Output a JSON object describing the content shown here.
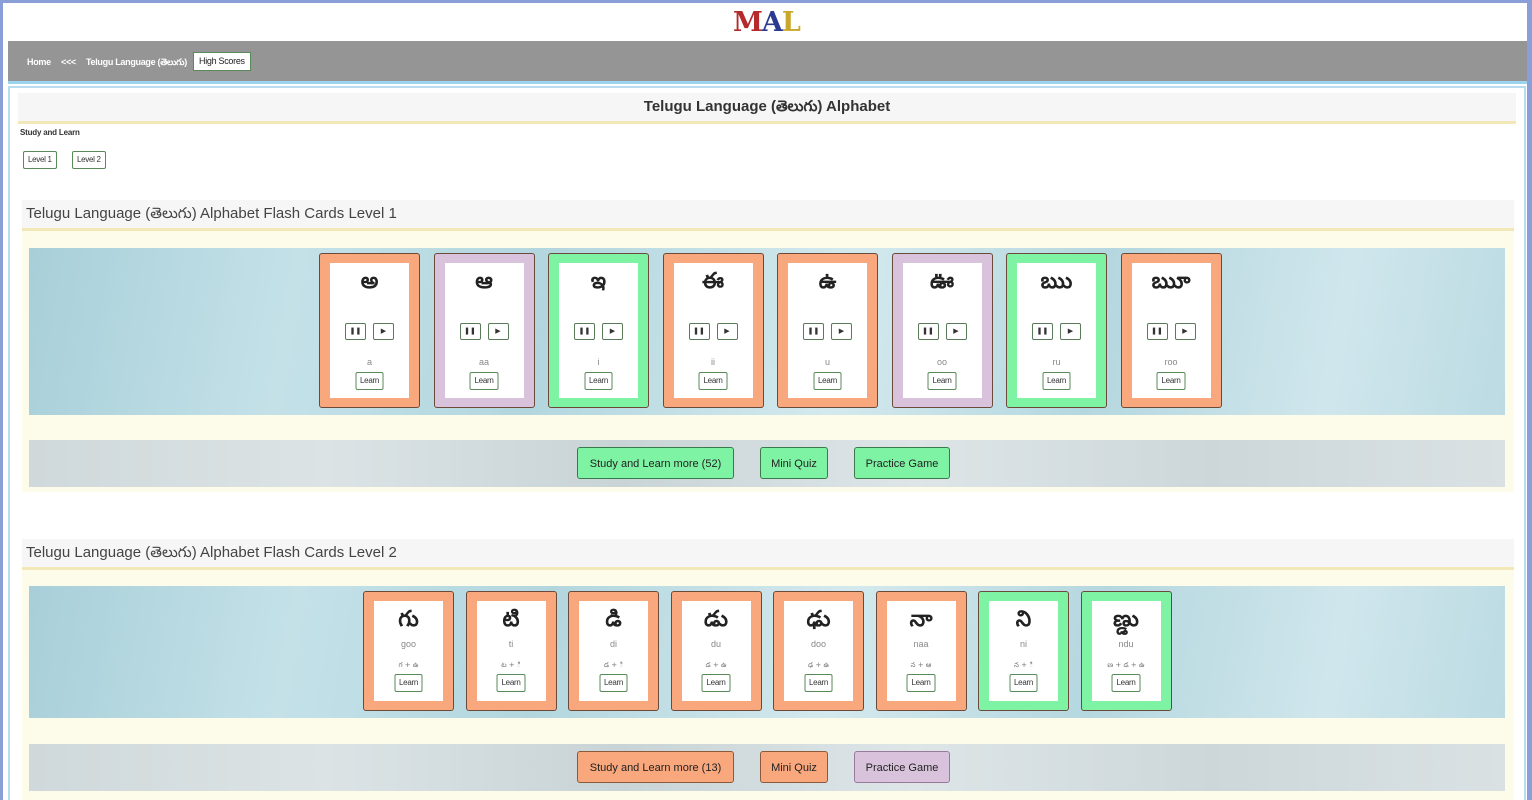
{
  "logo": {
    "text": "MAL"
  },
  "nav": {
    "home": "Home",
    "back": "<<<",
    "current": "Telugu Language (తెలుగు)",
    "high_scores": "High Scores"
  },
  "page": {
    "title": "Telugu Language (తెలుగు) Alphabet",
    "study_label": "Study and Learn",
    "levels": [
      "Level 1",
      "Level 2"
    ]
  },
  "colors": {
    "orange": "#f9a77c",
    "purple": "#d9c3dc",
    "green": "#7ff3a4"
  },
  "level1": {
    "heading": "Telugu Language (తెలుగు) Alphabet Flash Cards Level 1",
    "cards": [
      {
        "glyph": "అ",
        "translit": "a",
        "color": "orange",
        "learn": "Learn",
        "pause": "❚❚",
        "play": "▶"
      },
      {
        "glyph": "ఆ",
        "translit": "aa",
        "color": "purple",
        "learn": "Learn",
        "pause": "❚❚",
        "play": "▶"
      },
      {
        "glyph": "ఇ",
        "translit": "i",
        "color": "green",
        "learn": "Learn",
        "pause": "❚❚",
        "play": "▶"
      },
      {
        "glyph": "ఈ",
        "translit": "ii",
        "color": "orange",
        "learn": "Learn",
        "pause": "❚❚",
        "play": "▶"
      },
      {
        "glyph": "ఉ",
        "translit": "u",
        "color": "orange",
        "learn": "Learn",
        "pause": "❚❚",
        "play": "▶"
      },
      {
        "glyph": "ఊ",
        "translit": "oo",
        "color": "purple",
        "learn": "Learn",
        "pause": "❚❚",
        "play": "▶"
      },
      {
        "glyph": "ఋ",
        "translit": "ru",
        "color": "green",
        "learn": "Learn",
        "pause": "❚❚",
        "play": "▶"
      },
      {
        "glyph": "ౠ",
        "translit": "roo",
        "color": "orange",
        "learn": "Learn",
        "pause": "❚❚",
        "play": "▶"
      }
    ],
    "buttons": [
      {
        "label": "Study and Learn more (52)",
        "color": "green"
      },
      {
        "label": "Mini Quiz",
        "color": "green"
      },
      {
        "label": "Practice Game",
        "color": "green"
      }
    ]
  },
  "level2": {
    "heading": "Telugu Language (తెలుగు) Alphabet Flash Cards Level 2",
    "cards": [
      {
        "glyph": "గు",
        "translit": "goo",
        "parts": "గ + ఉ",
        "color": "orange",
        "learn": "Learn"
      },
      {
        "glyph": "టి",
        "translit": "ti",
        "parts": "ట + ి",
        "color": "orange",
        "learn": "Learn"
      },
      {
        "glyph": "డి",
        "translit": "di",
        "parts": "డ + ి",
        "color": "orange",
        "learn": "Learn"
      },
      {
        "glyph": "డు",
        "translit": "du",
        "parts": "డ + ఉ",
        "color": "orange",
        "learn": "Learn"
      },
      {
        "glyph": "ఢు",
        "translit": "doo",
        "parts": "ఢ + ఉ",
        "color": "orange",
        "learn": "Learn"
      },
      {
        "glyph": "నా",
        "translit": "naa",
        "parts": "న + ఆ",
        "color": "orange",
        "learn": "Learn"
      },
      {
        "glyph": "ని",
        "translit": "ni",
        "parts": "న + ి",
        "color": "green",
        "learn": "Learn"
      },
      {
        "glyph": "ణ్డు",
        "translit": "ndu",
        "parts": "ణ + డ + ఉ",
        "color": "green",
        "learn": "Learn"
      }
    ],
    "buttons": [
      {
        "label": "Study and Learn more (13)",
        "color": "orange"
      },
      {
        "label": "Mini Quiz",
        "color": "orange"
      },
      {
        "label": "Practice Game",
        "color": "purple"
      }
    ]
  }
}
